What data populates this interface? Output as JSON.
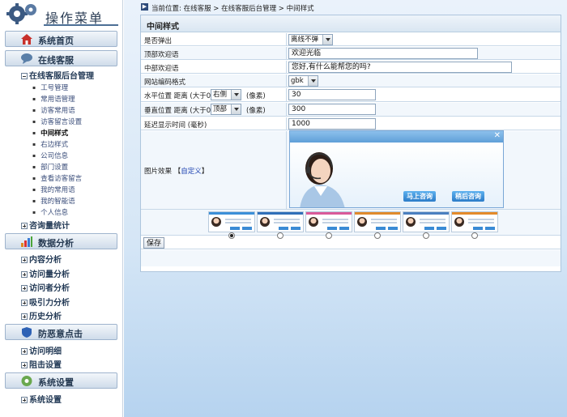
{
  "sidebar": {
    "title": "操作菜单",
    "sections": [
      {
        "label": "系统首页",
        "icon": "house-icon"
      },
      {
        "label": "在线客服",
        "icon": "chat-icon"
      },
      {
        "label": "数据分析",
        "icon": "bar-chart-icon"
      },
      {
        "label": "防恶意点击",
        "icon": "shield-icon"
      },
      {
        "label": "系统设置",
        "icon": "settings-icon"
      }
    ],
    "tree": {
      "service_admin": "在线客服后台管理",
      "service_items": [
        "工号管理",
        "常用语管理",
        "访客常用语",
        "访客留言设置",
        "中间样式",
        "右边样式",
        "公司信息",
        "部门设置",
        "查看访客留言",
        "我的常用语",
        "我的智能语",
        "个人信息"
      ],
      "consult_stats": "咨询量统计",
      "analysis_items": [
        "内容分析",
        "访问量分析",
        "访问者分析",
        "吸引力分析",
        "历史分析"
      ],
      "click_items": [
        "访问明细",
        "阻击设置"
      ],
      "settings_items": [
        "系统设置"
      ]
    }
  },
  "breadcrumb": "当前位置: 在线客服 > 在线客服后台管理 > 中间样式",
  "panel": {
    "title": "中间样式",
    "rows": {
      "popup": {
        "label": "是否弹出",
        "value": "离线不弹"
      },
      "top_greeting": {
        "label": "顶部欢迎语",
        "value": "欢迎光临"
      },
      "mid_greeting": {
        "label": "中部欢迎语",
        "value": "您好,有什么能帮您的吗?"
      },
      "encoding": {
        "label": "网站编码格式",
        "value": "gbk"
      },
      "hpos": {
        "label": "水平位置  距离 (大于0)",
        "select": "右侧",
        "unit": "(像素)",
        "value": "30"
      },
      "vpos": {
        "label": "垂直位置  距离 (大于0)",
        "select": "顶部",
        "unit": "(像素)",
        "value": "300"
      },
      "delay": {
        "label": "延迟显示时间 (毫秒)",
        "value": "1000"
      },
      "image": {
        "label": "图片效果 【",
        "custom_link": "自定义",
        "label_end": "】"
      }
    },
    "preview": {
      "consult_now": "马上咨询",
      "consult_later": "稍后咨询",
      "close": "✕"
    },
    "selected_theme_index": 0,
    "save_label": "保存"
  },
  "colors": {
    "accent": "#2c7cc8",
    "header_text": "#263a52"
  }
}
